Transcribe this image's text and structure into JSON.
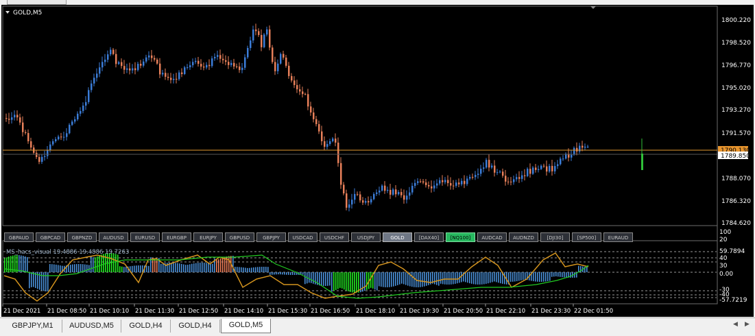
{
  "chart_window": {
    "title": "GOLD,M5",
    "price_labels": [
      "1800.220",
      "1798.520",
      "1796.770",
      "1795.020",
      "1793.270",
      "1791.570",
      "1789.850",
      "1788.070",
      "1786.320",
      "1784.620"
    ],
    "ask_price": "1790.130",
    "bid_price": "1789.850",
    "colors": {
      "bull": "#3b7dd8",
      "bear": "#e8805a",
      "ask_line": "#e39a30",
      "bg": "#000000"
    }
  },
  "symbols": {
    "items": [
      "GBPAUD",
      "GBPCAD",
      "GBPNZD",
      "AUDUSD",
      "EURUSD",
      "EURGBP",
      "EURJPY",
      "GBPUSD",
      "GBPJPY",
      "USDCAD",
      "USDCHF",
      "USDJPY",
      "GOLD",
      "[DAX40]",
      "[NQ100]",
      "AUDCAD",
      "AUDNZD",
      "[DJI30]",
      "[SP500]",
      "EURAUD"
    ],
    "active": "GOLD",
    "highlight": "[NQ100]"
  },
  "indicator": {
    "title": "MS_hacs_visual 19.4886 19.4886 19.7263",
    "scale_labels": [
      "100",
      "20",
      "59.7894",
      "40",
      "30",
      "0.00",
      "-30",
      "-40",
      "-57.7219"
    ],
    "colors": {
      "hist": "#4a90d8",
      "green": "#22ee22",
      "orange_bar": "#f07e5a",
      "line_orange": "#d4941e",
      "line_green": "#22cc22"
    }
  },
  "time_axis": {
    "labels": [
      "21 Dec 2021",
      "21 Dec 08:50",
      "21 Dec 10:10",
      "21 Dec 11:30",
      "21 Dec 12:50",
      "21 Dec 14:10",
      "21 Dec 15:30",
      "21 Dec 16:50",
      "21 Dec 18:10",
      "21 Dec 19:30",
      "21 Dec 20:50",
      "21 Dec 22:10",
      "21 Dec 23:30",
      "22 Dec 01:50"
    ]
  },
  "tabs": {
    "items": [
      "GBPJPY,M1",
      "AUDUSD,M5",
      "GOLD,H4",
      "GOLD,H4",
      "GOLD,M5"
    ],
    "active_index": 4
  }
}
